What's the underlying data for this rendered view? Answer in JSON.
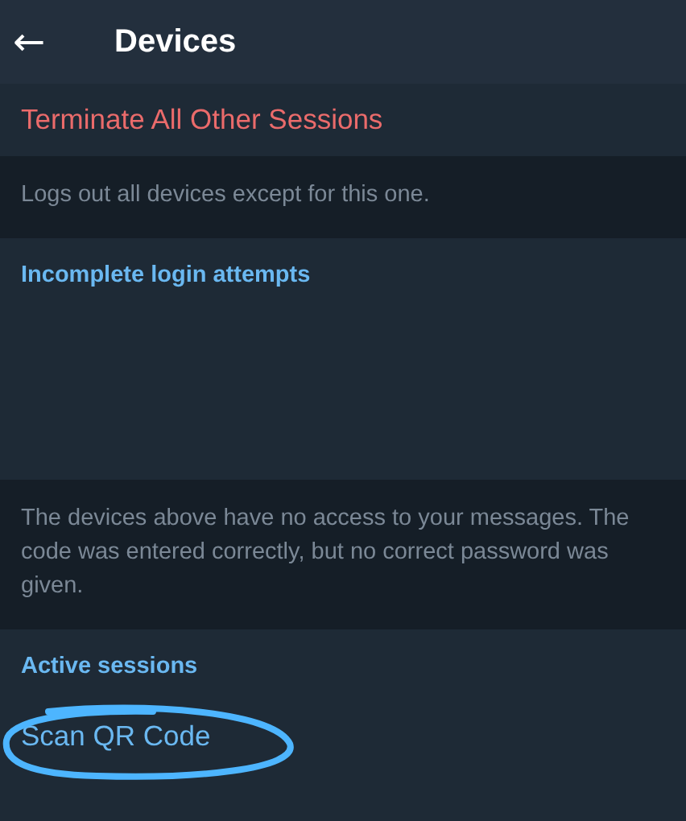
{
  "header": {
    "back_icon": "←",
    "title": "Devices"
  },
  "sections": [
    {
      "kind": "action",
      "text": "Terminate All Other Sessions"
    },
    {
      "kind": "note",
      "text": "Logs out all devices except for this one."
    },
    {
      "kind": "heading",
      "text": "Incomplete login attempts",
      "empty": true
    },
    {
      "kind": "note",
      "text": "The devices above have no access to your messages. The code was entered correctly, but no correct password was given."
    },
    {
      "kind": "heading",
      "text": "Active sessions",
      "empty": false
    },
    {
      "kind": "link",
      "text": "Scan QR Code",
      "circled": true
    }
  ]
}
